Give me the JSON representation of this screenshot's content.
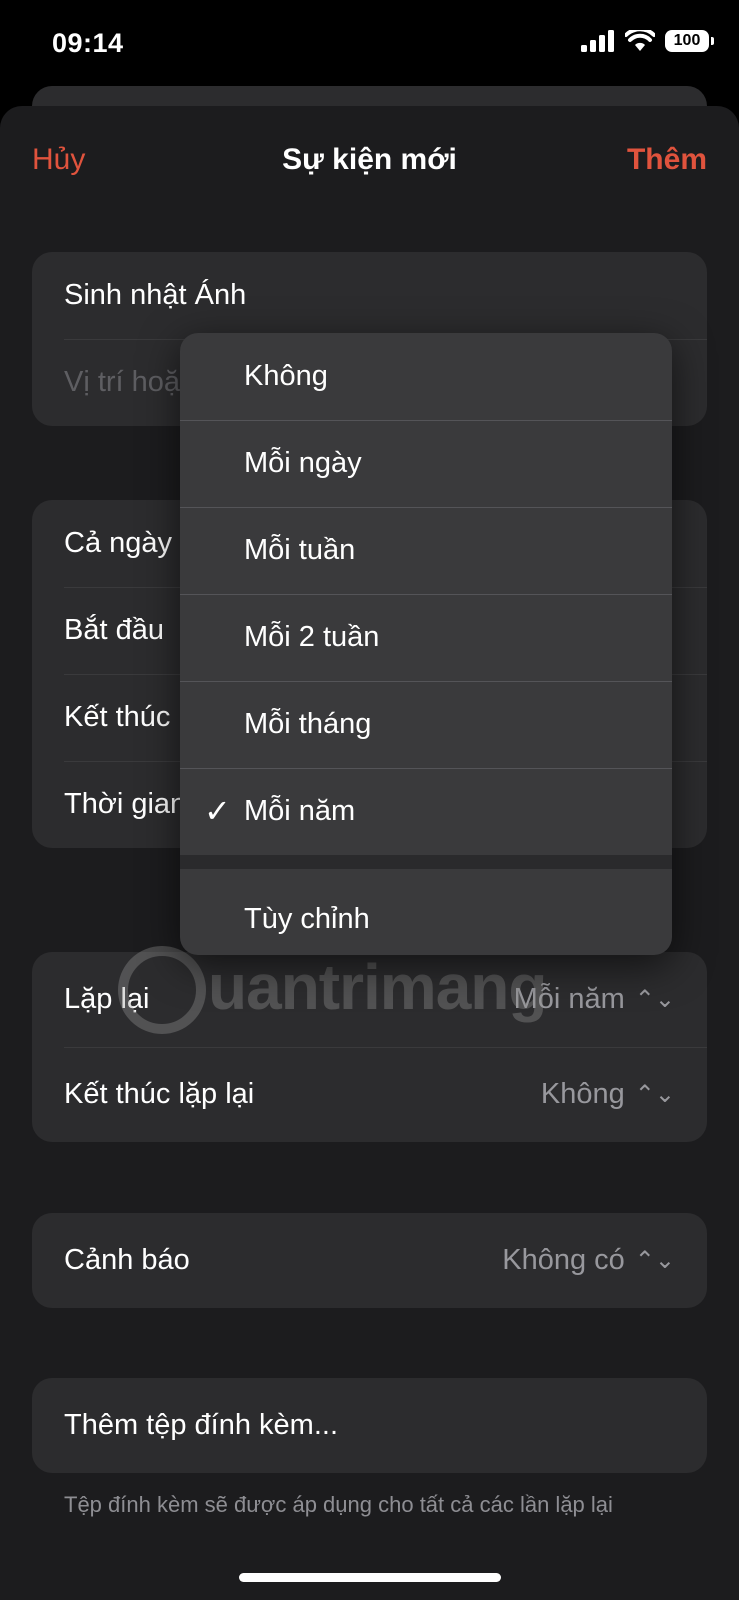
{
  "status_bar": {
    "time": "09:14",
    "battery": "100"
  },
  "nav": {
    "cancel": "Hủy",
    "title": "Sự kiện mới",
    "add": "Thêm"
  },
  "event": {
    "title": "Sinh nhật Ánh",
    "location_placeholder": "Vị trí hoặc Cuộc gọi video"
  },
  "time_group": {
    "all_day": "Cả ngày",
    "start": "Bắt đầu",
    "end": "Kết thúc",
    "travel": "Thời gian di chuyển"
  },
  "repeat_group": {
    "repeat_label": "Lặp lại",
    "repeat_value": "Mỗi năm",
    "end_repeat_label": "Kết thúc lặp lại",
    "end_repeat_value": "Không"
  },
  "alert_group": {
    "label": "Cảnh báo",
    "value": "Không có"
  },
  "attachment": {
    "label": "Thêm tệp đính kèm...",
    "note": "Tệp đính kèm sẽ được áp dụng cho tất cả các lần lặp lại"
  },
  "repeat_menu": {
    "items": [
      "Không",
      "Mỗi ngày",
      "Mỗi tuần",
      "Mỗi 2 tuần",
      "Mỗi tháng",
      "Mỗi năm"
    ],
    "selected": "Mỗi năm",
    "custom": "Tùy chỉnh"
  },
  "watermark": {
    "text": "uantrimang"
  },
  "colors": {
    "accent": "#e0533d",
    "background": "#1c1c1e",
    "card": "#2c2c2e",
    "menu": "#3a3a3c"
  }
}
